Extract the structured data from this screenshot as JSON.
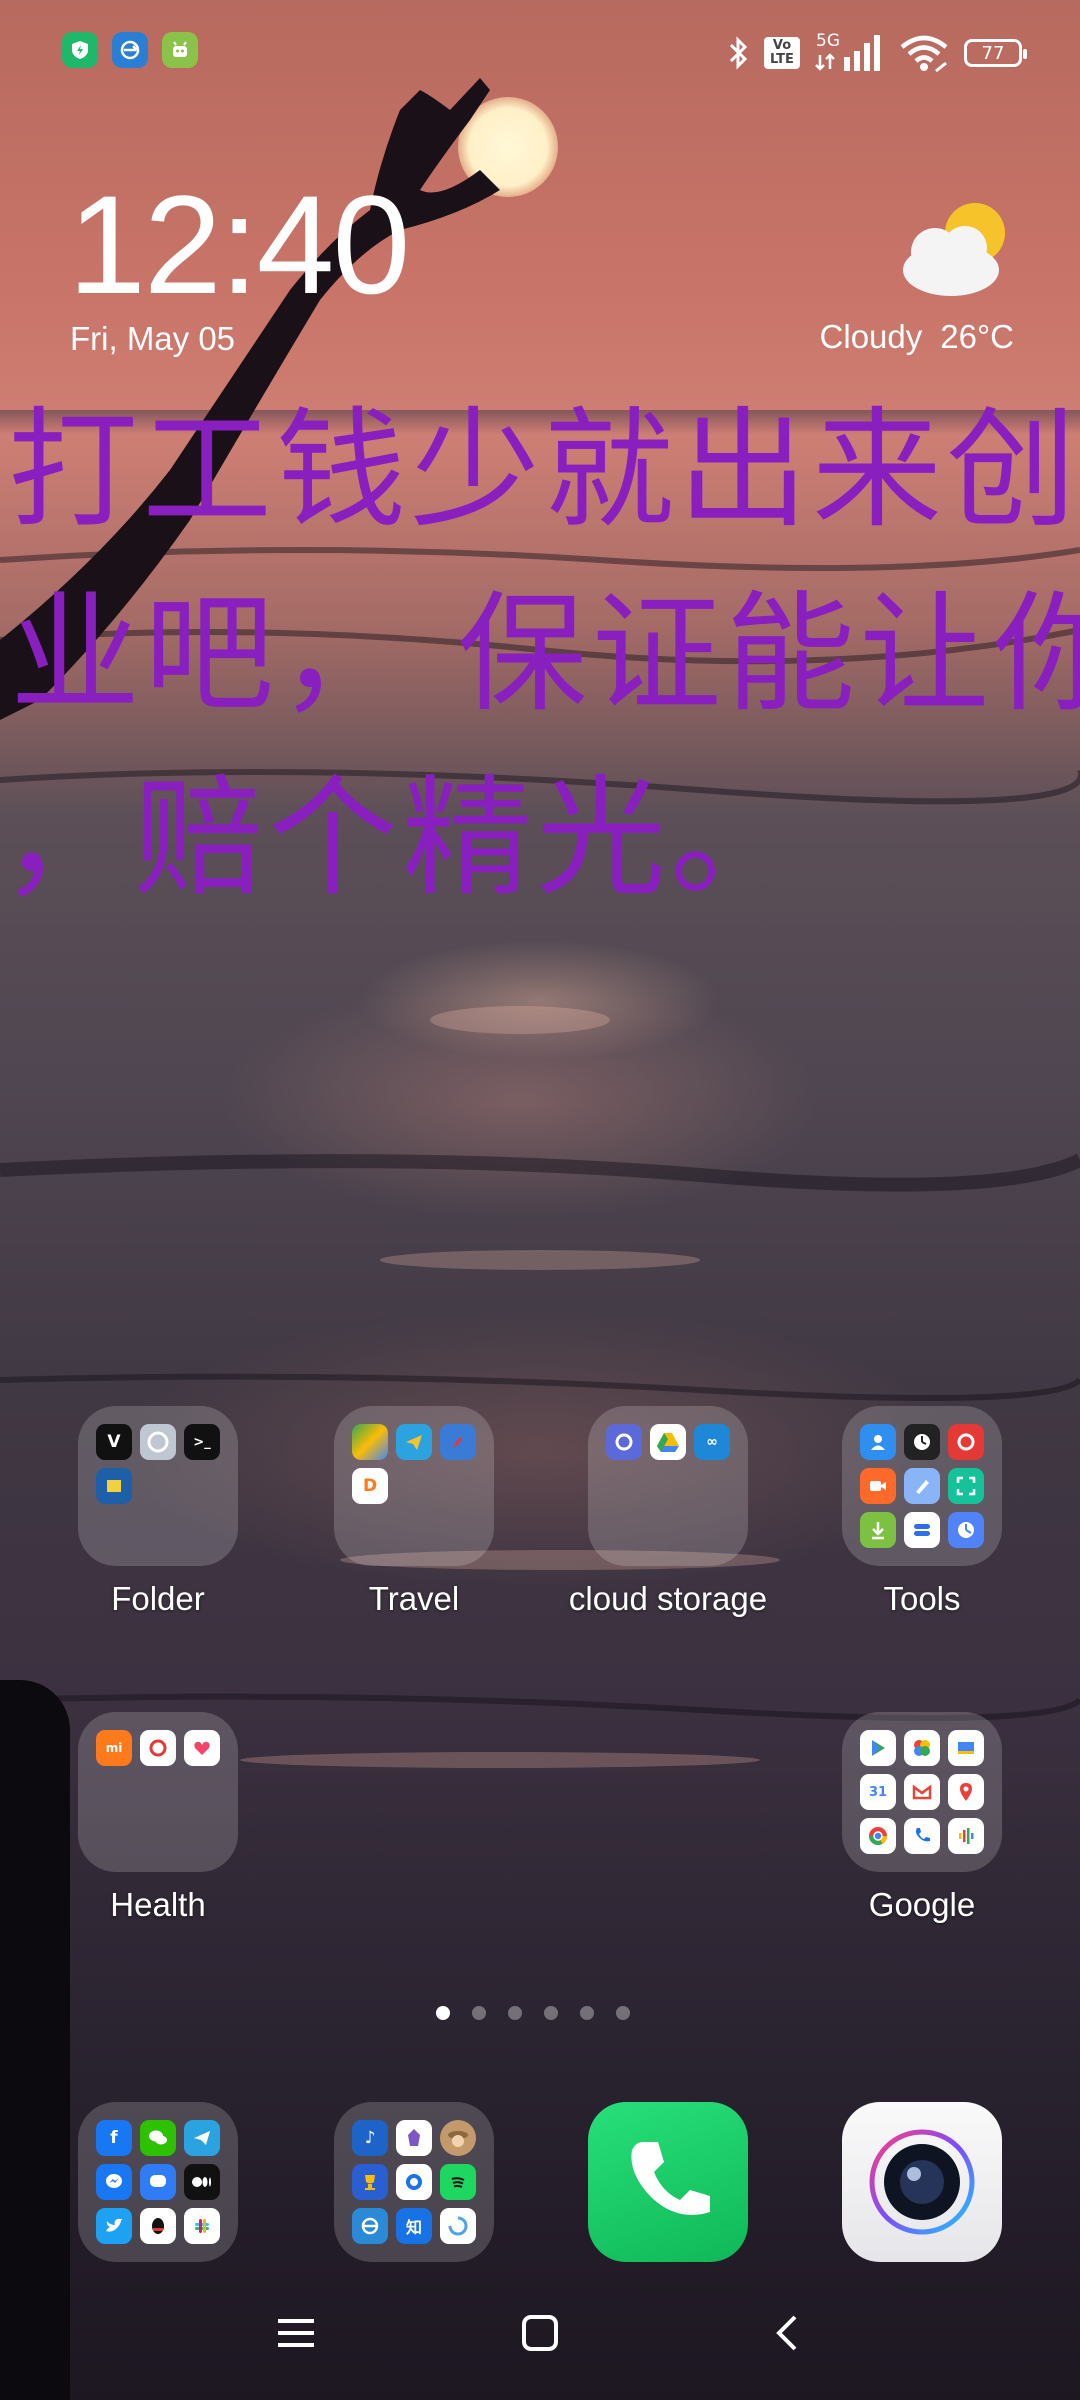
{
  "status_bar": {
    "notification_apps": [
      "shield-app-icon",
      "sync-app-icon",
      "android-app-icon"
    ],
    "network_label": "5G",
    "volte_label": "Vo LTE",
    "battery_level": "77"
  },
  "lock_widget": {
    "time": "12:40",
    "date": "Fri, May 05",
    "weather_condition": "Cloudy",
    "temperature": "26°C"
  },
  "wallpaper_overlay": {
    "lines": [
      "打工钱少就出来创",
      "业吧，  保证能让你",
      "，赔个精光。"
    ]
  },
  "home_folders": [
    {
      "name": "Folder",
      "apps": [
        "vivaldi",
        "wheel",
        "terminal",
        "scanner"
      ]
    },
    {
      "name": "Travel",
      "apps": [
        "maps",
        "telegram-nav",
        "compass",
        "didi"
      ]
    },
    {
      "name": "cloud storage",
      "apps": [
        "nextcloud-c",
        "google-drive",
        "nextcloud"
      ]
    },
    {
      "name": "Tools",
      "apps": [
        "contacts",
        "clock",
        "recorder",
        "video",
        "notes",
        "scanner",
        "download",
        "toggle",
        "clock-blue"
      ]
    },
    {
      "name": "Health",
      "apps": [
        "mi-fit",
        "ring",
        "heart"
      ]
    },
    {
      "name": "Google",
      "apps": [
        "play-store",
        "photos",
        "slides",
        "calendar",
        "gmail",
        "maps",
        "chrome",
        "phone",
        "podcasts"
      ]
    }
  ],
  "page_indicator": {
    "total": 6,
    "active": 1
  },
  "dock": {
    "items": [
      "social-folder",
      "media-folder",
      "phone",
      "camera"
    ]
  },
  "nav_bar": {
    "buttons": [
      "menu",
      "home",
      "back"
    ]
  },
  "colors": {
    "overlay_text": "#8a1fbf",
    "phone_green": "#1fd36b"
  }
}
